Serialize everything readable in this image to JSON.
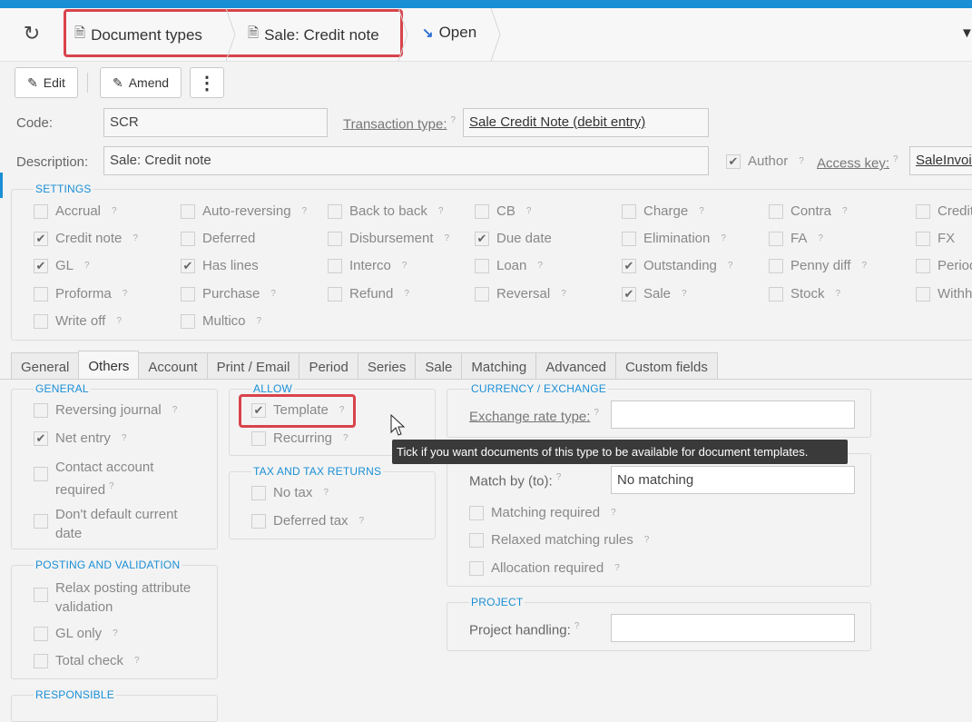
{
  "breadcrumbs": [
    {
      "label": "Document types"
    },
    {
      "label": "Sale: Credit note"
    },
    {
      "label": "Open"
    }
  ],
  "toolbar": {
    "edit_label": "Edit",
    "amend_label": "Amend",
    "more_label": "⋮"
  },
  "form": {
    "code_label": "Code:",
    "code_value": "SCR",
    "transaction_type_label": "Transaction type:",
    "transaction_type_value": "Sale Credit Note (debit entry)",
    "description_label": "Description:",
    "description_value": "Sale: Credit note",
    "author_label": "Author",
    "author_checked": true,
    "access_key_label": "Access key:",
    "access_key_value": "SaleInvoic"
  },
  "settings": {
    "title": "SETTINGS",
    "columns": [
      [
        {
          "label": "Accrual",
          "checked": false
        },
        {
          "label": "Credit note",
          "checked": true
        },
        {
          "label": "GL",
          "checked": true
        },
        {
          "label": "Proforma",
          "checked": false
        },
        {
          "label": "Write off",
          "checked": false
        }
      ],
      [
        {
          "label": "Auto-reversing",
          "checked": false
        },
        {
          "label": "Deferred",
          "checked": false,
          "noq": true
        },
        {
          "label": "Has lines",
          "checked": true,
          "noq": true
        },
        {
          "label": "Purchase",
          "checked": false
        },
        {
          "label": "Multico",
          "checked": false
        }
      ],
      [
        {
          "label": "Back to back",
          "checked": false
        },
        {
          "label": "Disbursement",
          "checked": false
        },
        {
          "label": "Interco",
          "checked": false
        },
        {
          "label": "Refund",
          "checked": false
        }
      ],
      [
        {
          "label": "CB",
          "checked": false
        },
        {
          "label": "Due date",
          "checked": true,
          "noq": true
        },
        {
          "label": "Loan",
          "checked": false
        },
        {
          "label": "Reversal",
          "checked": false
        }
      ],
      [
        {
          "label": "Charge",
          "checked": false
        },
        {
          "label": "Elimination",
          "checked": false
        },
        {
          "label": "Outstanding",
          "checked": true
        },
        {
          "label": "Sale",
          "checked": true
        }
      ],
      [
        {
          "label": "Contra",
          "checked": false
        },
        {
          "label": "FA",
          "checked": false
        },
        {
          "label": "Penny diff",
          "checked": false
        },
        {
          "label": "Stock",
          "checked": false
        }
      ],
      [
        {
          "label": "Credit",
          "checked": false
        },
        {
          "label": "FX",
          "checked": false
        },
        {
          "label": "Period",
          "checked": false
        },
        {
          "label": "Withh",
          "checked": false
        }
      ]
    ]
  },
  "tabs": [
    "General",
    "Others",
    "Account",
    "Print / Email",
    "Period",
    "Series",
    "Sale",
    "Matching",
    "Advanced",
    "Custom fields"
  ],
  "active_tab": "Others",
  "others": {
    "general": {
      "title": "GENERAL",
      "items": [
        {
          "label": "Reversing journal",
          "checked": false
        },
        {
          "label": "Net entry",
          "checked": true
        },
        {
          "label": "Contact account required",
          "checked": false
        },
        {
          "label": "Don't default current date",
          "checked": false
        }
      ]
    },
    "posting": {
      "title": "POSTING AND VALIDATION",
      "items": [
        {
          "label": "Relax posting attribute validation",
          "checked": false
        },
        {
          "label": "GL only",
          "checked": false
        },
        {
          "label": "Total check",
          "checked": false
        }
      ]
    },
    "responsible": {
      "title": "RESPONSIBLE"
    },
    "allow": {
      "title": "ALLOW",
      "items": [
        {
          "label": "Template",
          "checked": true
        },
        {
          "label": "Recurring",
          "checked": false
        }
      ]
    },
    "tax": {
      "title": "TAX AND TAX RETURNS",
      "items": [
        {
          "label": "No tax",
          "checked": false
        },
        {
          "label": "Deferred tax",
          "checked": false
        }
      ]
    },
    "currency": {
      "title": "CURRENCY / EXCHANGE",
      "exchange_rate_type_label": "Exchange rate type:",
      "exchange_rate_type_value": ""
    },
    "matching": {
      "match_by_label": "Match by (to):",
      "match_by_value": "No matching",
      "items": [
        {
          "label": "Matching required",
          "checked": false
        },
        {
          "label": "Relaxed matching rules",
          "checked": false
        },
        {
          "label": "Allocation required",
          "checked": false
        }
      ]
    },
    "project": {
      "title": "PROJECT",
      "project_handling_label": "Project handling:",
      "project_handling_value": ""
    }
  },
  "tooltip": "Tick if you want documents of this type to be available for document templates.",
  "help_mark": "?",
  "check_mark": "✔"
}
